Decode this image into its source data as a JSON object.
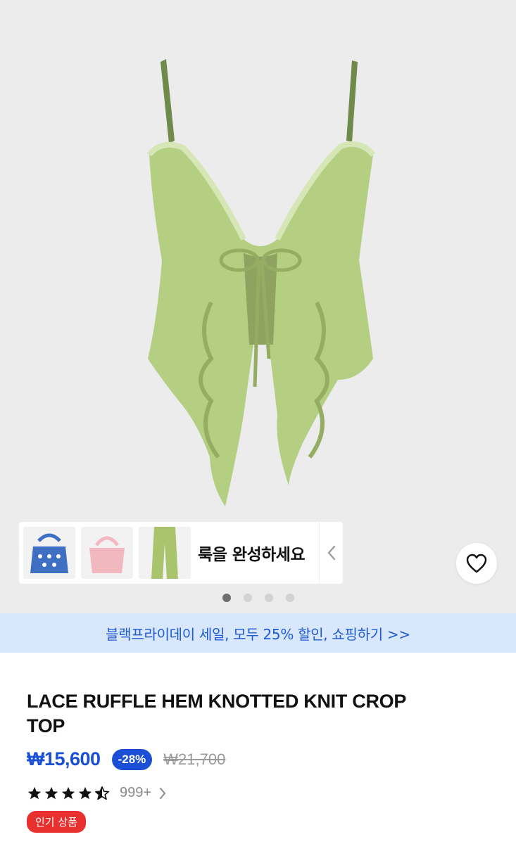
{
  "gallery": {
    "look_label": "룩을 완성하세요",
    "look_items": [
      {
        "name": "blue-heart-knit-bag",
        "color": "#3f6fc2"
      },
      {
        "name": "pink-knit-bag",
        "color": "#f2b8c0"
      },
      {
        "name": "green-knit-pants",
        "color": "#a9c46c"
      }
    ],
    "page_count": 4,
    "active_page": 0
  },
  "icons": {
    "favorite": "heart-outline-icon",
    "look_toggle": "chevron-left-icon",
    "review_link": "chevron-right-icon"
  },
  "promo": {
    "text": "블랙프라이데이 세일, 모두 25% 할인, 쇼핑하기 >>"
  },
  "product": {
    "title": "LACE RUFFLE HEM KNOTTED KNIT CROP TOP",
    "price": "₩15,600",
    "discount": "-28%",
    "original_price": "₩21,700",
    "rating": 4.5,
    "review_count": "999+",
    "badge": "인기 상품"
  },
  "colors": {
    "accent": "#1a4fd6",
    "banner_bg": "#d8e7fb",
    "badge_red": "#e8312f",
    "garment_green": "#b4cf82"
  }
}
